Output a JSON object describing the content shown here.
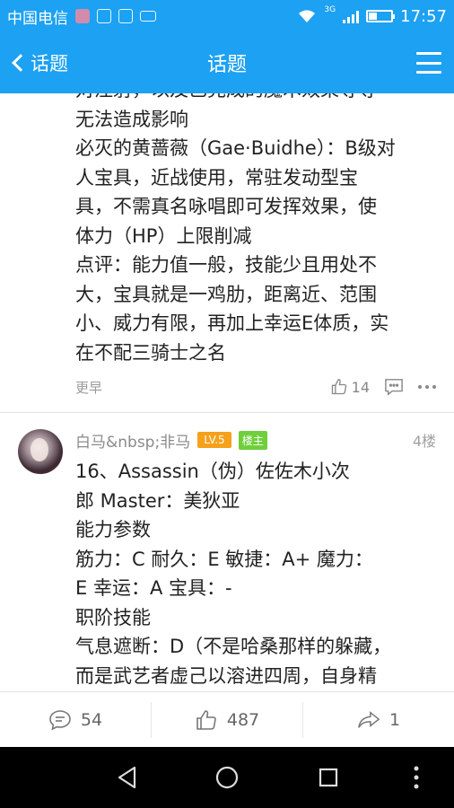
{
  "status_bar": {
    "carrier": "中国电信",
    "network_type": "3G",
    "time": "17:57",
    "battery_level": 0.35
  },
  "nav": {
    "back_label": "话题",
    "title": "话题",
    "menu_icon": "hamburger-icon"
  },
  "post_1": {
    "lines": [
      "对注射，以及已完成的魔术效果等等",
      "无法造成影响",
      "必灭的黄蔷薇（Gae·Buidhe）：B级对",
      "人宝具，近战使用，常驻发动型宝",
      "具，不需真名咏唱即可发挥效果，使",
      "体力（HP）上限削减",
      "点评：能力值一般，技能少且用处不",
      "大，宝具就是一鸡肋，距离近、范围",
      "小、威力有限，再加上幸运E体质，实",
      "在不配三骑士之名"
    ],
    "time": "更早",
    "likes": "14"
  },
  "post_2": {
    "username": "白马&nbsp;非马",
    "level": "LV.5",
    "host_badge": "楼主",
    "floor": "4楼",
    "lines": [
      "16、Assassin（伪）佐佐木小次",
      "郎 Master：美狄亚",
      "能力参数",
      "筋力：C 耐久：E 敏捷：A+ 魔力：",
      "E 幸运：A 宝具：-",
      "职阶技能",
      "气息遮断：D（不是哈桑那样的躲藏，",
      "而是武艺者虚己以溶进四周，自身精"
    ]
  },
  "action_bar": {
    "comments": "54",
    "likes": "487",
    "shares": "1"
  },
  "colors": {
    "brand": "#1da1f2",
    "level_badge": "#f5a11a",
    "host_badge": "#6fcf3a"
  }
}
